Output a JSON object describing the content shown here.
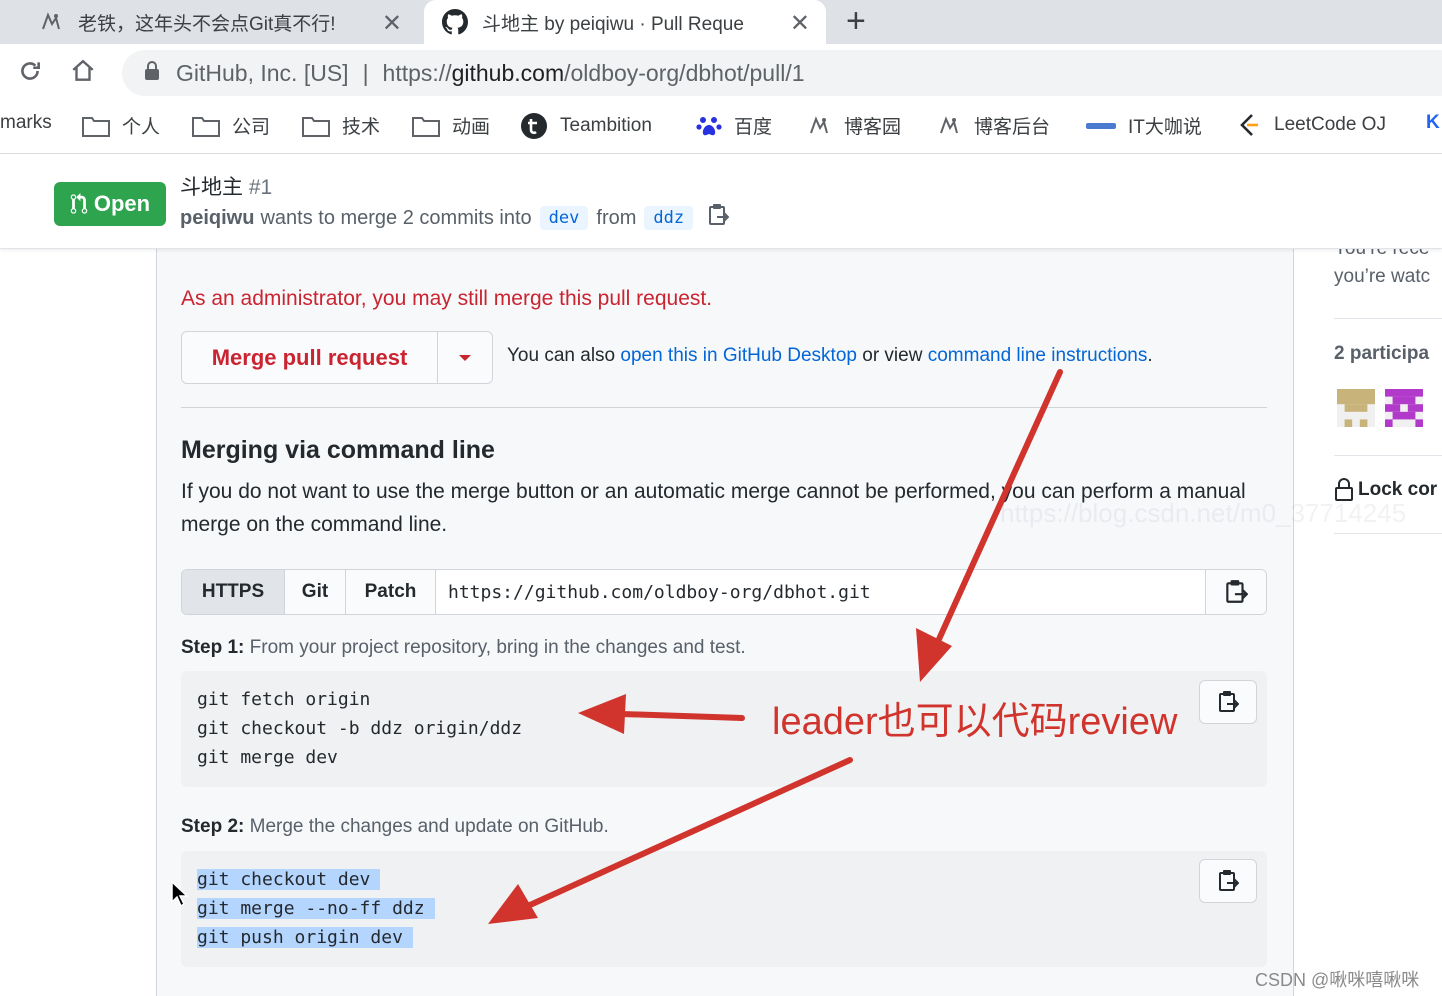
{
  "browser": {
    "tabs": [
      {
        "title": "老铁，这年头不会点Git真不行!",
        "close": "✕"
      },
      {
        "title": "斗地主 by peiqiwu · Pull Reque",
        "close": "✕"
      }
    ],
    "new_tab": "+",
    "address": {
      "cert": "GitHub, Inc. [US]",
      "separator": "|",
      "url_scheme": "https://",
      "url_host": "github.com",
      "url_path": "/oldboy-org/dbhot/pull/1"
    },
    "bookmarks": [
      {
        "label": "marks",
        "icon": "none"
      },
      {
        "label": "个人",
        "icon": "folder-icon"
      },
      {
        "label": "公司",
        "icon": "folder-icon"
      },
      {
        "label": "技术",
        "icon": "folder-icon"
      },
      {
        "label": "动画",
        "icon": "folder-icon"
      },
      {
        "label": "Teambition",
        "icon": "teambition-icon"
      },
      {
        "label": "百度",
        "icon": "baidu-paw-icon"
      },
      {
        "label": "博客园",
        "icon": "cnblogs-icon"
      },
      {
        "label": "博客后台",
        "icon": "cnblogs-icon"
      },
      {
        "label": "IT大咖说",
        "icon": "itdks-icon"
      },
      {
        "label": "LeetCode OJ",
        "icon": "leetcode-icon"
      },
      {
        "label": "K",
        "icon": "none"
      }
    ]
  },
  "pr": {
    "state": "Open",
    "title": "斗地主",
    "number": "#1",
    "author": "peiqiwu",
    "merge_text": "wants to merge 2 commits into",
    "base_branch": "dev",
    "from_text": "from",
    "head_branch": "ddz"
  },
  "merge": {
    "admin_note": "As an administrator, you may still merge this pull request.",
    "button_label": "Merge pull request",
    "also_prefix": "You can also",
    "desktop_link": "open this in GitHub Desktop",
    "also_middle": "or view",
    "cli_link": "command line instructions",
    "also_suffix": "."
  },
  "command_line": {
    "title": "Merging via command line",
    "description": "If you do not want to use the merge button or an automatic merge cannot be performed, you can perform a manual merge on the command line.",
    "protocols": [
      "HTTPS",
      "Git",
      "Patch"
    ],
    "active_protocol": "HTTPS",
    "clone_url": "https://github.com/oldboy-org/dbhot.git",
    "step1_label": "Step 1:",
    "step1_text": "From your project repository, bring in the changes and test.",
    "step1_code": [
      "git fetch origin",
      "git checkout -b ddz origin/ddz",
      "git merge dev"
    ],
    "step2_label": "Step 2:",
    "step2_text": "Merge the changes and update on GitHub.",
    "step2_code": [
      "git checkout dev",
      "git merge --no-ff ddz",
      "git push origin dev"
    ]
  },
  "sidebar": {
    "cut_text": "You’re rece",
    "watching": "you’re watc",
    "participants": "2 participa",
    "lock": "Lock cor"
  },
  "annotation": {
    "text": "leader也可以代码review",
    "color": "#d0342c"
  },
  "watermark": "https://blog.csdn.net/m0_37714245",
  "credit": "CSDN @啾咪嘻啾咪"
}
